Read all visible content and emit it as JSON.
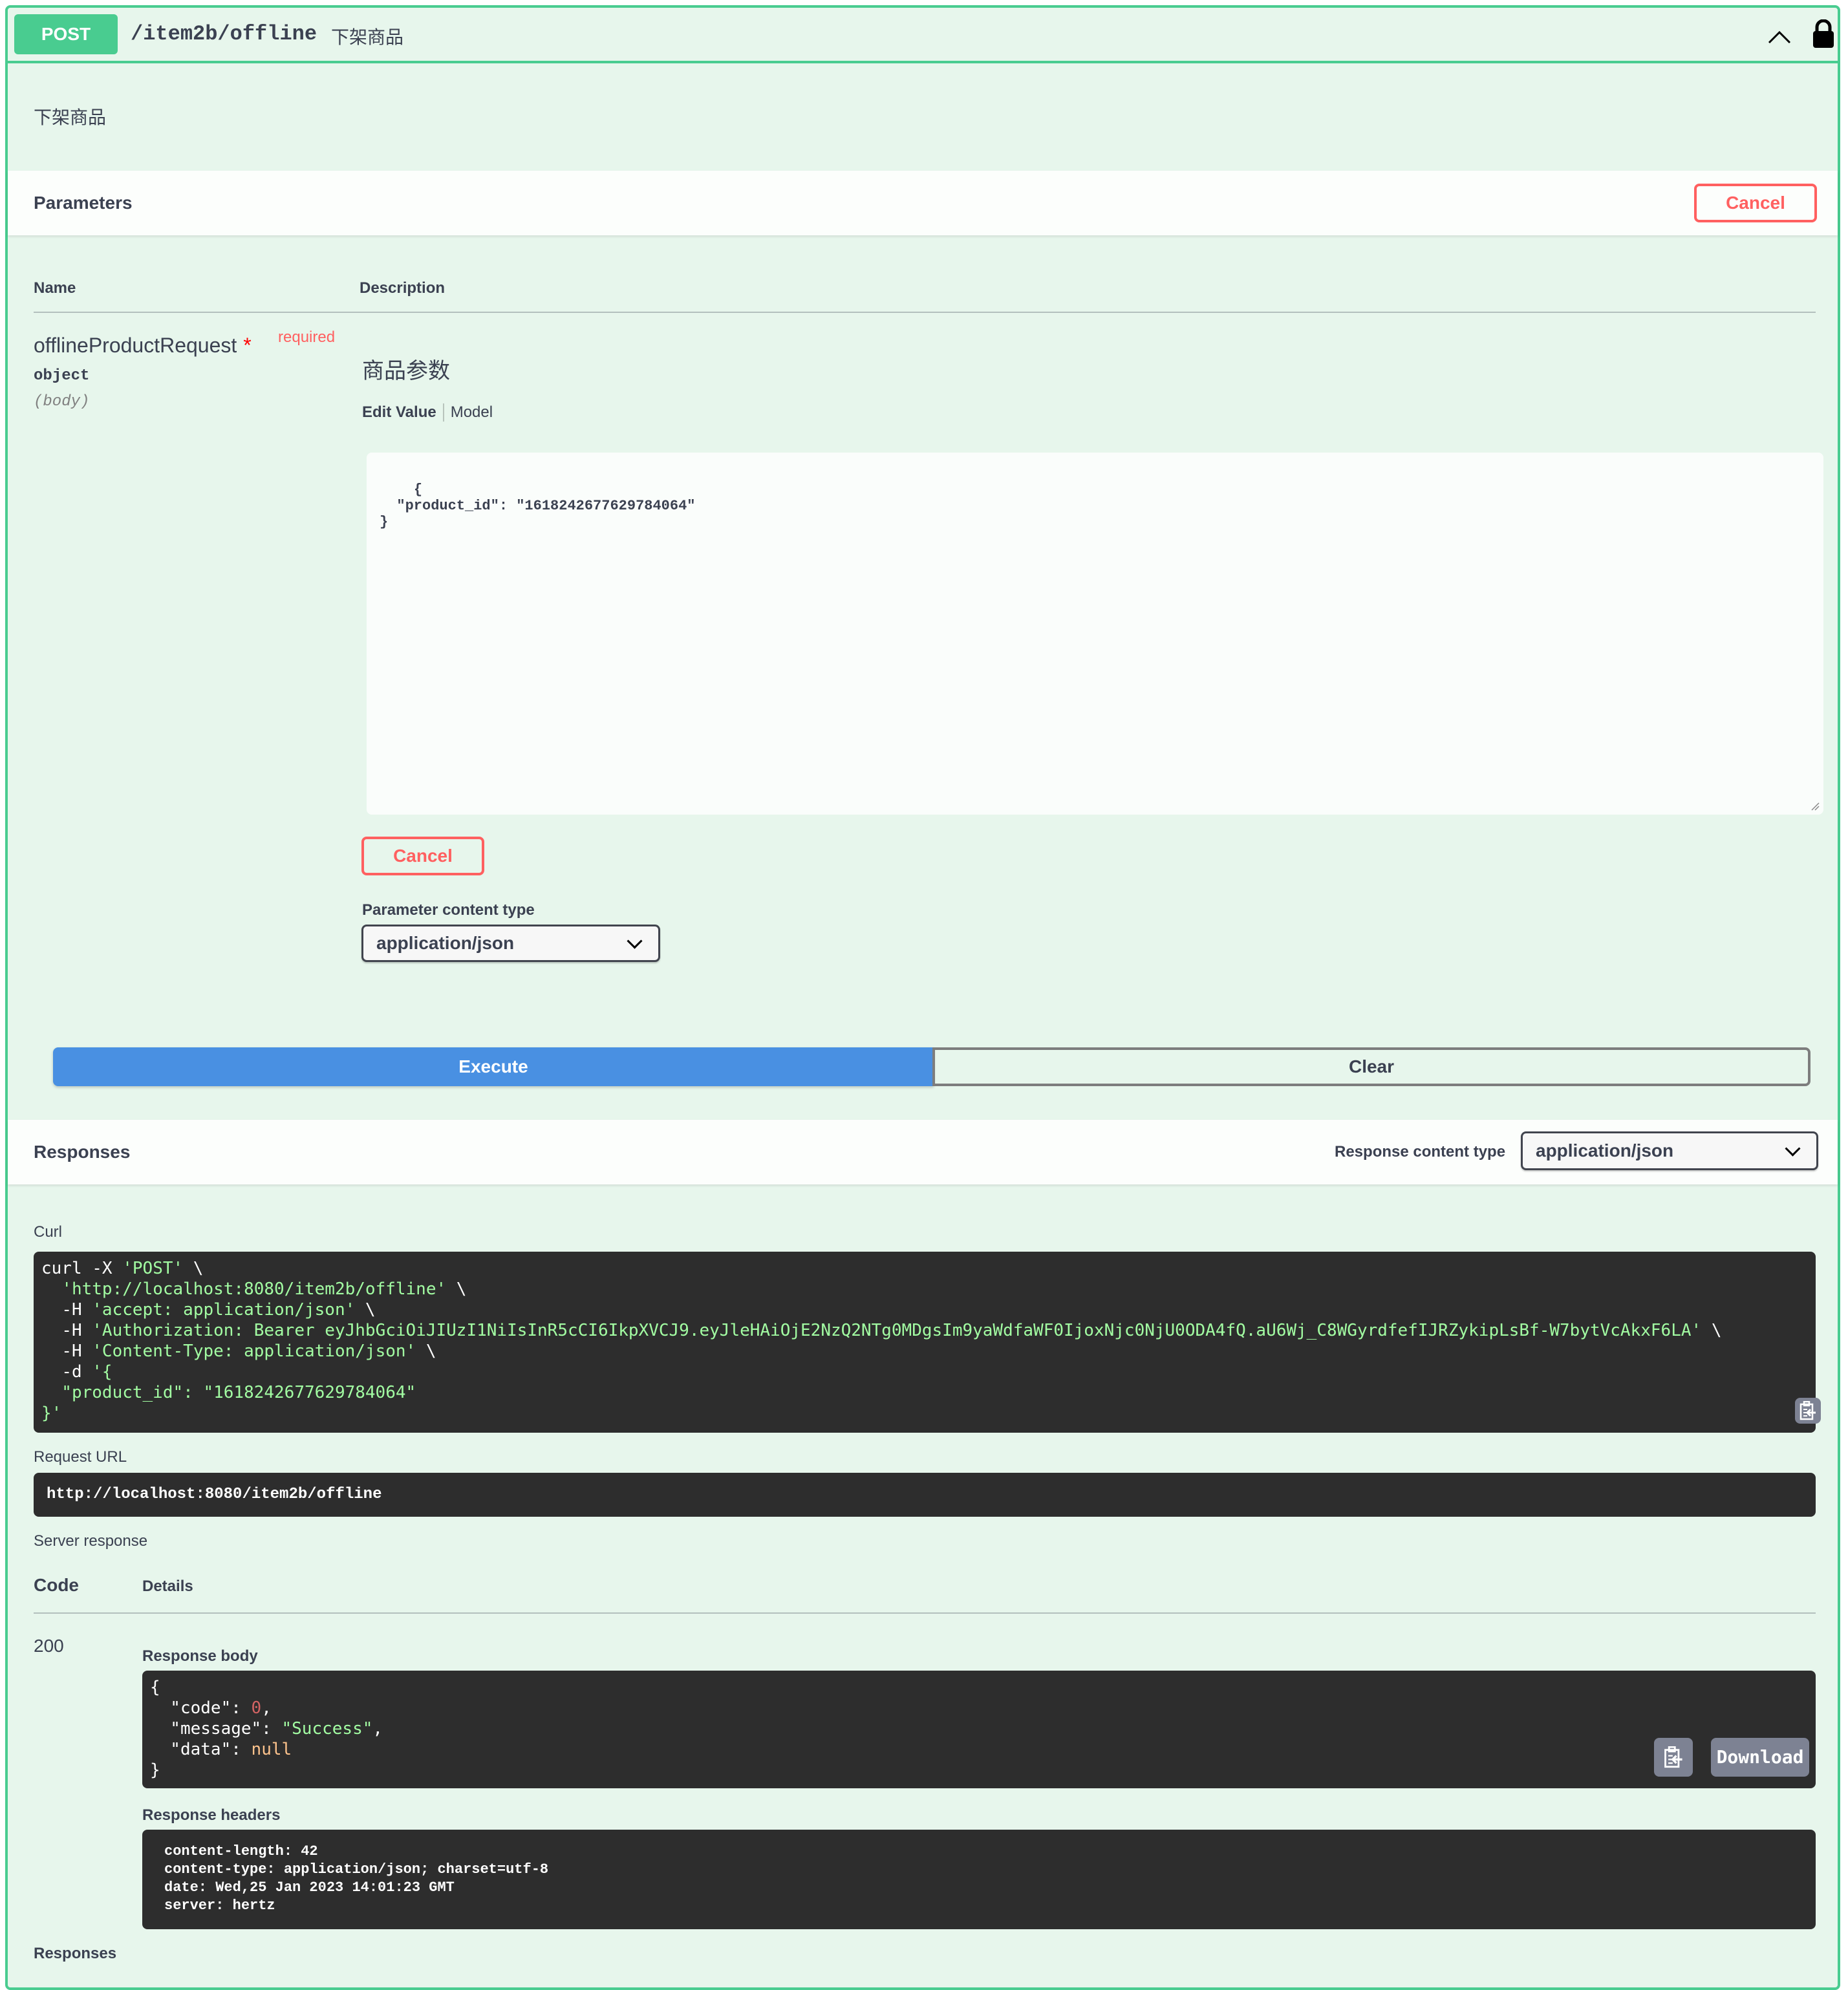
{
  "operation": {
    "method": "POST",
    "path": "/item2b/offline",
    "summary": "下架商品",
    "description": "下架商品",
    "colors": {
      "method": "#49cc90",
      "background": "#e7f6ec",
      "cancel": "#ff6060",
      "execute": "#4990e2"
    },
    "icons": {
      "collapse": "chevron-up-icon",
      "auth": "lock-icon"
    }
  },
  "parameters": {
    "title": "Parameters",
    "cancel_label": "Cancel",
    "columns": {
      "name": "Name",
      "description": "Description"
    },
    "items": [
      {
        "name": "offlineProductRequest",
        "required_star": "*",
        "required_label": "required",
        "type": "object",
        "in": "(body)",
        "description": "商品参数",
        "tabs": [
          "Edit Value",
          "Model"
        ],
        "value": "{\n  \"product_id\": \"1618242677629784064\"\n}"
      }
    ],
    "body_cancel_label": "Cancel",
    "content_type_label": "Parameter content type",
    "content_type_value": "application/json"
  },
  "actions": {
    "execute_label": "Execute",
    "clear_label": "Clear"
  },
  "responses": {
    "title": "Responses",
    "content_type_label": "Response content type",
    "content_type_value": "application/json",
    "curl_label": "Curl",
    "curl": {
      "line1_cmd": "curl -X ",
      "line1_str": "'POST'",
      "line1_tail": " \\",
      "line2_str": "'http://localhost:8080/item2b/offline'",
      "line3_flag": "-H ",
      "line3_str": "'accept: application/json'",
      "line4_flag": "-H ",
      "line4_str": "'Authorization: Bearer eyJhbGciOiJIUzI1NiIsInR5cCI6IkpXVCJ9.eyJleHAiOjE2NzQ2NTg0MDgsIm9yaWdfaWF0IjoxNjc0NjU0ODA4fQ.aU6Wj_C8WGyrdfefIJRZykipLsBf-W7bytVcAkxF6LA'",
      "line5_flag": "-H ",
      "line5_str": "'Content-Type: application/json'",
      "line6_flag": "-d ",
      "line6_str": "'{",
      "line7_str": "  \"product_id\": \"1618242677629784064\"",
      "line8_str": "}'",
      "backslash": " \\"
    },
    "request_url_label": "Request URL",
    "request_url": "http://localhost:8080/item2b/offline",
    "server_response_label": "Server response",
    "code_header": "Code",
    "details_header": "Details",
    "status_code": "200",
    "response_body_label": "Response body",
    "response_body": {
      "open": "{",
      "code_key": "  \"code\": ",
      "code_val": "0",
      "message_key": "  \"message\": ",
      "message_val": "\"Success\"",
      "data_key": "  \"data\": ",
      "data_val": "null",
      "close": "}",
      "comma": ","
    },
    "download_label": "Download",
    "response_headers_label": "Response headers",
    "response_headers": [
      "content-length: 42",
      "content-type: application/json; charset=utf-8",
      "date: Wed,25 Jan 2023 14:01:23 GMT",
      "server: hertz"
    ],
    "responses_footer_label": "Responses"
  }
}
